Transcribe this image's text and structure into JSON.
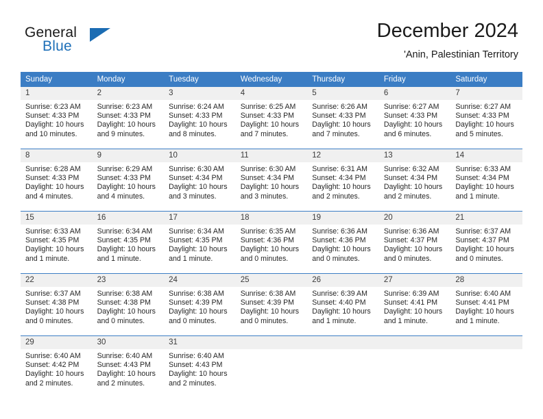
{
  "brand": {
    "name_part1": "General",
    "name_part2": "Blue",
    "flag_icon": "triangle-flag-icon",
    "accent_color": "#1b6cb3"
  },
  "header": {
    "title": "December 2024",
    "subtitle": "'Anin, Palestinian Territory"
  },
  "calendar": {
    "header_bg": "#3b7dc4",
    "daynum_bg": "#f0f0f0",
    "weekday_headers": [
      "Sunday",
      "Monday",
      "Tuesday",
      "Wednesday",
      "Thursday",
      "Friday",
      "Saturday"
    ],
    "weeks": [
      [
        {
          "day": "1",
          "sunrise": "Sunrise: 6:23 AM",
          "sunset": "Sunset: 4:33 PM",
          "daylight_line1": "Daylight: 10 hours",
          "daylight_line2": "and 10 minutes."
        },
        {
          "day": "2",
          "sunrise": "Sunrise: 6:23 AM",
          "sunset": "Sunset: 4:33 PM",
          "daylight_line1": "Daylight: 10 hours",
          "daylight_line2": "and 9 minutes."
        },
        {
          "day": "3",
          "sunrise": "Sunrise: 6:24 AM",
          "sunset": "Sunset: 4:33 PM",
          "daylight_line1": "Daylight: 10 hours",
          "daylight_line2": "and 8 minutes."
        },
        {
          "day": "4",
          "sunrise": "Sunrise: 6:25 AM",
          "sunset": "Sunset: 4:33 PM",
          "daylight_line1": "Daylight: 10 hours",
          "daylight_line2": "and 7 minutes."
        },
        {
          "day": "5",
          "sunrise": "Sunrise: 6:26 AM",
          "sunset": "Sunset: 4:33 PM",
          "daylight_line1": "Daylight: 10 hours",
          "daylight_line2": "and 7 minutes."
        },
        {
          "day": "6",
          "sunrise": "Sunrise: 6:27 AM",
          "sunset": "Sunset: 4:33 PM",
          "daylight_line1": "Daylight: 10 hours",
          "daylight_line2": "and 6 minutes."
        },
        {
          "day": "7",
          "sunrise": "Sunrise: 6:27 AM",
          "sunset": "Sunset: 4:33 PM",
          "daylight_line1": "Daylight: 10 hours",
          "daylight_line2": "and 5 minutes."
        }
      ],
      [
        {
          "day": "8",
          "sunrise": "Sunrise: 6:28 AM",
          "sunset": "Sunset: 4:33 PM",
          "daylight_line1": "Daylight: 10 hours",
          "daylight_line2": "and 4 minutes."
        },
        {
          "day": "9",
          "sunrise": "Sunrise: 6:29 AM",
          "sunset": "Sunset: 4:33 PM",
          "daylight_line1": "Daylight: 10 hours",
          "daylight_line2": "and 4 minutes."
        },
        {
          "day": "10",
          "sunrise": "Sunrise: 6:30 AM",
          "sunset": "Sunset: 4:34 PM",
          "daylight_line1": "Daylight: 10 hours",
          "daylight_line2": "and 3 minutes."
        },
        {
          "day": "11",
          "sunrise": "Sunrise: 6:30 AM",
          "sunset": "Sunset: 4:34 PM",
          "daylight_line1": "Daylight: 10 hours",
          "daylight_line2": "and 3 minutes."
        },
        {
          "day": "12",
          "sunrise": "Sunrise: 6:31 AM",
          "sunset": "Sunset: 4:34 PM",
          "daylight_line1": "Daylight: 10 hours",
          "daylight_line2": "and 2 minutes."
        },
        {
          "day": "13",
          "sunrise": "Sunrise: 6:32 AM",
          "sunset": "Sunset: 4:34 PM",
          "daylight_line1": "Daylight: 10 hours",
          "daylight_line2": "and 2 minutes."
        },
        {
          "day": "14",
          "sunrise": "Sunrise: 6:33 AM",
          "sunset": "Sunset: 4:34 PM",
          "daylight_line1": "Daylight: 10 hours",
          "daylight_line2": "and 1 minute."
        }
      ],
      [
        {
          "day": "15",
          "sunrise": "Sunrise: 6:33 AM",
          "sunset": "Sunset: 4:35 PM",
          "daylight_line1": "Daylight: 10 hours",
          "daylight_line2": "and 1 minute."
        },
        {
          "day": "16",
          "sunrise": "Sunrise: 6:34 AM",
          "sunset": "Sunset: 4:35 PM",
          "daylight_line1": "Daylight: 10 hours",
          "daylight_line2": "and 1 minute."
        },
        {
          "day": "17",
          "sunrise": "Sunrise: 6:34 AM",
          "sunset": "Sunset: 4:35 PM",
          "daylight_line1": "Daylight: 10 hours",
          "daylight_line2": "and 1 minute."
        },
        {
          "day": "18",
          "sunrise": "Sunrise: 6:35 AM",
          "sunset": "Sunset: 4:36 PM",
          "daylight_line1": "Daylight: 10 hours",
          "daylight_line2": "and 0 minutes."
        },
        {
          "day": "19",
          "sunrise": "Sunrise: 6:36 AM",
          "sunset": "Sunset: 4:36 PM",
          "daylight_line1": "Daylight: 10 hours",
          "daylight_line2": "and 0 minutes."
        },
        {
          "day": "20",
          "sunrise": "Sunrise: 6:36 AM",
          "sunset": "Sunset: 4:37 PM",
          "daylight_line1": "Daylight: 10 hours",
          "daylight_line2": "and 0 minutes."
        },
        {
          "day": "21",
          "sunrise": "Sunrise: 6:37 AM",
          "sunset": "Sunset: 4:37 PM",
          "daylight_line1": "Daylight: 10 hours",
          "daylight_line2": "and 0 minutes."
        }
      ],
      [
        {
          "day": "22",
          "sunrise": "Sunrise: 6:37 AM",
          "sunset": "Sunset: 4:38 PM",
          "daylight_line1": "Daylight: 10 hours",
          "daylight_line2": "and 0 minutes."
        },
        {
          "day": "23",
          "sunrise": "Sunrise: 6:38 AM",
          "sunset": "Sunset: 4:38 PM",
          "daylight_line1": "Daylight: 10 hours",
          "daylight_line2": "and 0 minutes."
        },
        {
          "day": "24",
          "sunrise": "Sunrise: 6:38 AM",
          "sunset": "Sunset: 4:39 PM",
          "daylight_line1": "Daylight: 10 hours",
          "daylight_line2": "and 0 minutes."
        },
        {
          "day": "25",
          "sunrise": "Sunrise: 6:38 AM",
          "sunset": "Sunset: 4:39 PM",
          "daylight_line1": "Daylight: 10 hours",
          "daylight_line2": "and 0 minutes."
        },
        {
          "day": "26",
          "sunrise": "Sunrise: 6:39 AM",
          "sunset": "Sunset: 4:40 PM",
          "daylight_line1": "Daylight: 10 hours",
          "daylight_line2": "and 1 minute."
        },
        {
          "day": "27",
          "sunrise": "Sunrise: 6:39 AM",
          "sunset": "Sunset: 4:41 PM",
          "daylight_line1": "Daylight: 10 hours",
          "daylight_line2": "and 1 minute."
        },
        {
          "day": "28",
          "sunrise": "Sunrise: 6:40 AM",
          "sunset": "Sunset: 4:41 PM",
          "daylight_line1": "Daylight: 10 hours",
          "daylight_line2": "and 1 minute."
        }
      ],
      [
        {
          "day": "29",
          "sunrise": "Sunrise: 6:40 AM",
          "sunset": "Sunset: 4:42 PM",
          "daylight_line1": "Daylight: 10 hours",
          "daylight_line2": "and 2 minutes."
        },
        {
          "day": "30",
          "sunrise": "Sunrise: 6:40 AM",
          "sunset": "Sunset: 4:43 PM",
          "daylight_line1": "Daylight: 10 hours",
          "daylight_line2": "and 2 minutes."
        },
        {
          "day": "31",
          "sunrise": "Sunrise: 6:40 AM",
          "sunset": "Sunset: 4:43 PM",
          "daylight_line1": "Daylight: 10 hours",
          "daylight_line2": "and 2 minutes."
        },
        {
          "day": "",
          "sunrise": "",
          "sunset": "",
          "daylight_line1": "",
          "daylight_line2": ""
        },
        {
          "day": "",
          "sunrise": "",
          "sunset": "",
          "daylight_line1": "",
          "daylight_line2": ""
        },
        {
          "day": "",
          "sunrise": "",
          "sunset": "",
          "daylight_line1": "",
          "daylight_line2": ""
        },
        {
          "day": "",
          "sunrise": "",
          "sunset": "",
          "daylight_line1": "",
          "daylight_line2": ""
        }
      ]
    ]
  }
}
